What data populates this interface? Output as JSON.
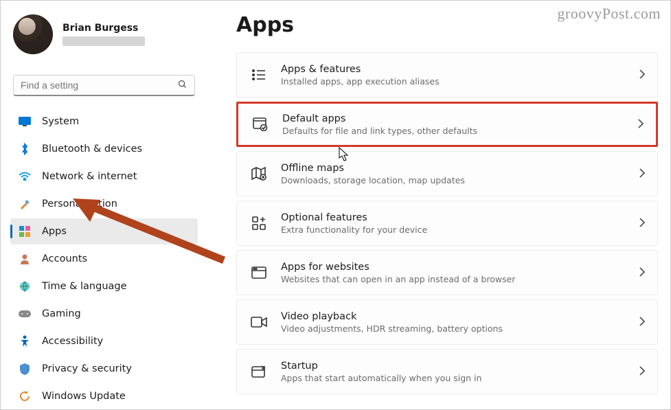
{
  "watermark": "groovyPost.com",
  "profile": {
    "name": "Brian Burgess"
  },
  "search": {
    "placeholder": "Find a setting"
  },
  "nav": [
    {
      "key": "system",
      "label": "System",
      "icon": "display"
    },
    {
      "key": "bluetooth",
      "label": "Bluetooth & devices",
      "icon": "bluetooth"
    },
    {
      "key": "network",
      "label": "Network & internet",
      "icon": "wifi"
    },
    {
      "key": "personalization",
      "label": "Personalization",
      "icon": "brush"
    },
    {
      "key": "apps",
      "label": "Apps",
      "icon": "apps",
      "selected": true
    },
    {
      "key": "accounts",
      "label": "Accounts",
      "icon": "person"
    },
    {
      "key": "time",
      "label": "Time & language",
      "icon": "globe"
    },
    {
      "key": "gaming",
      "label": "Gaming",
      "icon": "gaming"
    },
    {
      "key": "accessibility",
      "label": "Accessibility",
      "icon": "accessibility"
    },
    {
      "key": "privacy",
      "label": "Privacy & security",
      "icon": "shield"
    },
    {
      "key": "update",
      "label": "Windows Update",
      "icon": "update"
    }
  ],
  "page": {
    "title": "Apps"
  },
  "cards": [
    {
      "key": "apps-features",
      "title": "Apps & features",
      "sub": "Installed apps, app execution aliases",
      "icon": "list"
    },
    {
      "key": "default-apps",
      "title": "Default apps",
      "sub": "Defaults for file and link types, other defaults",
      "icon": "default",
      "highlight": true
    },
    {
      "key": "offline-maps",
      "title": "Offline maps",
      "sub": "Downloads, storage location, map updates",
      "icon": "map"
    },
    {
      "key": "optional-features",
      "title": "Optional features",
      "sub": "Extra functionality for your device",
      "icon": "plus-grid"
    },
    {
      "key": "apps-websites",
      "title": "Apps for websites",
      "sub": "Websites that can open in an app instead of a browser",
      "icon": "window"
    },
    {
      "key": "video-playback",
      "title": "Video playback",
      "sub": "Video adjustments, HDR streaming, battery options",
      "icon": "video"
    },
    {
      "key": "startup",
      "title": "Startup",
      "sub": "Apps that start automatically when you sign in",
      "icon": "startup"
    }
  ]
}
